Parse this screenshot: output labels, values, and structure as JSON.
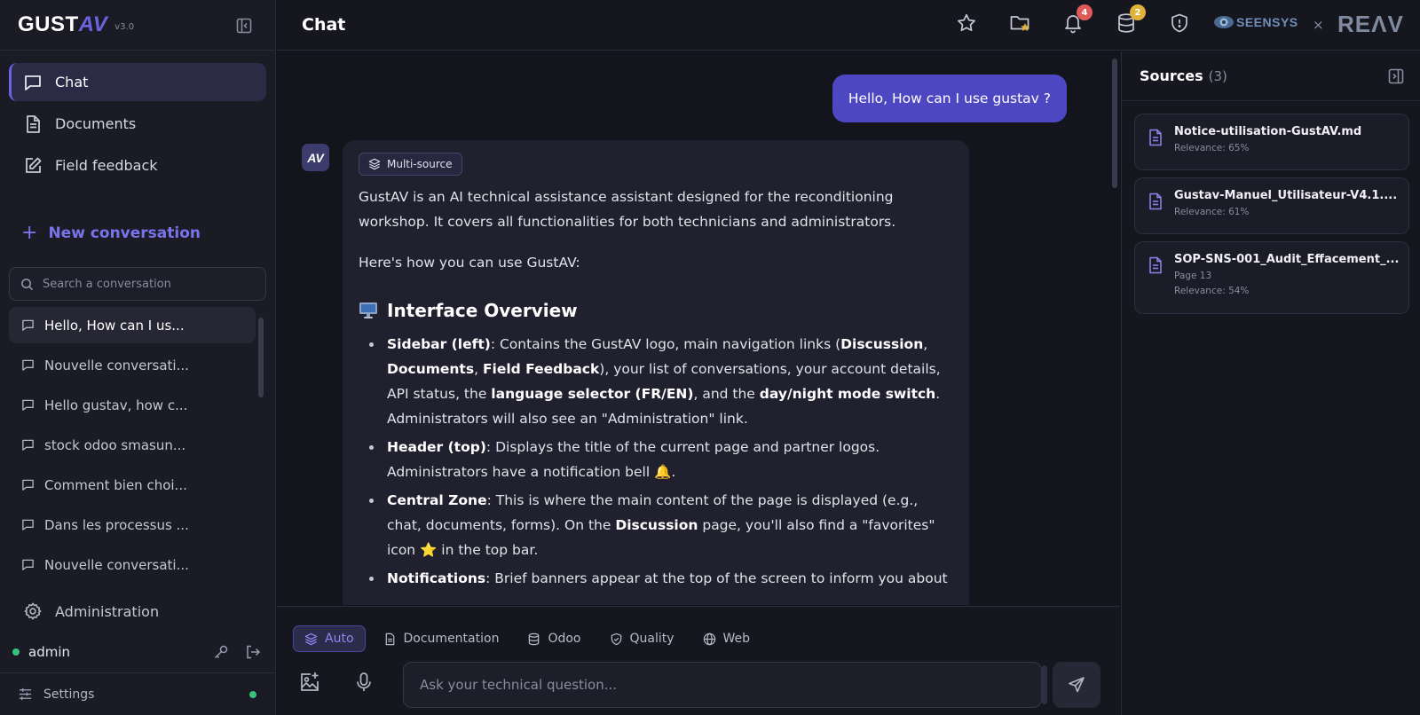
{
  "app": {
    "logo_main": "GUST",
    "logo_accent": "AV",
    "version": "v3.0"
  },
  "nav": {
    "items": [
      {
        "label": "Chat"
      },
      {
        "label": "Documents"
      },
      {
        "label": "Field feedback"
      }
    ]
  },
  "new_conversation": {
    "label": "New conversation"
  },
  "search": {
    "placeholder": "Search a conversation"
  },
  "conversations": [
    "Hello, How can I us...",
    "Nouvelle conversati...",
    "Hello gustav, how c...",
    "stock odoo smasun...",
    "Comment bien choi...",
    "Dans les processus ...",
    "Nouvelle conversati..."
  ],
  "sidebar_footer": {
    "admin_label": "Administration",
    "user": "admin",
    "settings_label": "Settings"
  },
  "header": {
    "title": "Chat",
    "notifications_count": "4",
    "database_count": "2",
    "partner1": "SEENSYS",
    "partner_separator": "×",
    "partner2": "REΛV"
  },
  "chat": {
    "user_message": "Hello, How can I use gustav ?",
    "bot_avatar": "AV",
    "chip_label": "Multi-source",
    "intro": "GustAV is an AI technical assistance assistant designed for the reconditioning workshop. It covers all functionalities for both technicians and administrators.",
    "howto": "Here's how you can use GustAV:",
    "section_title": "Interface Overview",
    "bullets": {
      "b1": {
        "t1": "Sidebar (left)",
        "t2": ": Contains the GustAV logo, main navigation links (",
        "t3": "Discussion",
        "t4": ", ",
        "t5": "Documents",
        "t6": ", ",
        "t7": "Field Feedback",
        "t8": "), your list of conversations, your account details, API status, the ",
        "t9": "language selector (FR/EN)",
        "t10": ", and the ",
        "t11": "day/night mode switch",
        "t12": ". Administrators will also see an \"Administration\" link."
      },
      "b2": {
        "t1": "Header (top)",
        "t2": ": Displays the title of the current page and partner logos. Administrators have a notification bell 🔔."
      },
      "b3": {
        "t1": "Central Zone",
        "t2": ": This is where the main content of the page is displayed (e.g., chat, documents, forms). On the ",
        "t3": "Discussion",
        "t4": " page, you'll also find a \"favorites\" icon ⭐ in the top bar."
      },
      "b4": {
        "t1": "Notifications",
        "t2": ": Brief banners appear at the top of the screen to inform you about"
      }
    }
  },
  "composer": {
    "modes": [
      "Auto",
      "Documentation",
      "Odoo",
      "Quality",
      "Web"
    ],
    "placeholder": "Ask your technical question..."
  },
  "sources": {
    "title": "Sources",
    "count": "(3)",
    "items": [
      {
        "name": "Notice-utilisation-GustAV.md",
        "relevance": "Relevance: 65%"
      },
      {
        "name": "Gustav-Manuel_Utilisateur-V4.1....",
        "relevance": "Relevance: 61%"
      },
      {
        "name": "SOP-SNS-001_Audit_Effacement_...",
        "page": "Page 13",
        "relevance": "Relevance: 54%"
      }
    ]
  },
  "colors": {
    "accent": "#6b63e0",
    "user_bubble": "#4d47c2",
    "online": "#36c47a",
    "badge_red": "#e05a5a",
    "badge_yellow": "#e0b23a"
  }
}
